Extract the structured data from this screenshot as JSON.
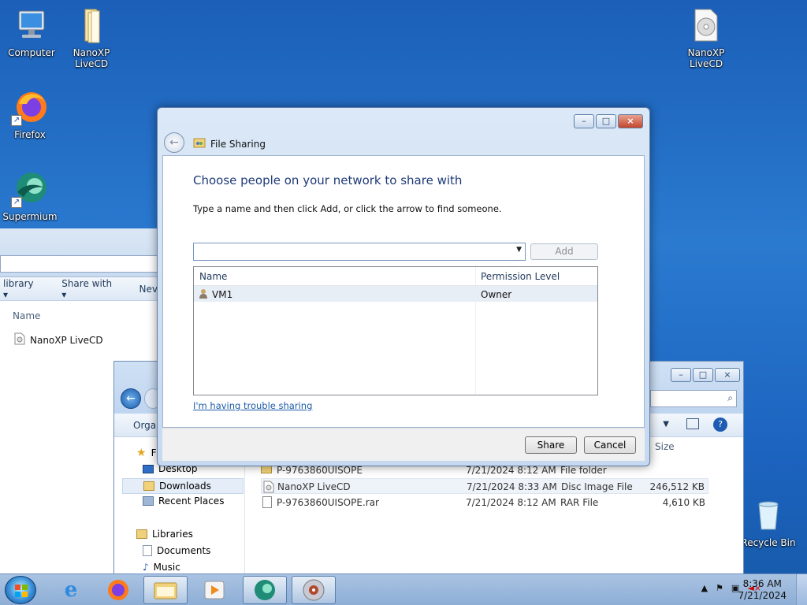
{
  "desktop": {
    "icons": [
      {
        "label": "Computer"
      },
      {
        "label": "NanoXP LiveCD"
      },
      {
        "label": "Firefox"
      },
      {
        "label": "Supermium"
      },
      {
        "label": "NanoXP LiveCD"
      },
      {
        "label": "Recycle Bin"
      }
    ]
  },
  "bg_explorer_left": {
    "toolbar": [
      "library ▾",
      "Share with ▾",
      "Nev"
    ],
    "column_name": "Name",
    "items": [
      "NanoXP LiveCD"
    ]
  },
  "bg_explorer_bottom": {
    "toolbar_left": "Orga",
    "col_size": "Size",
    "nav": {
      "favorites_partial": "F",
      "items": [
        "Desktop",
        "Downloads",
        "Recent Places"
      ],
      "libraries": "Libraries",
      "library_items": [
        "Documents",
        "Music"
      ]
    },
    "files": [
      {
        "name": "P-9763860UISOPE",
        "date": "7/21/2024 8:12 AM",
        "type": "File folder",
        "size": ""
      },
      {
        "name": "NanoXP LiveCD",
        "date": "7/21/2024 8:33 AM",
        "type": "Disc Image File",
        "size": "246,512 KB"
      },
      {
        "name": "P-9763860UISOPE.rar",
        "date": "7/21/2024 8:12 AM",
        "type": "RAR File",
        "size": "4,610 KB"
      }
    ]
  },
  "dialog": {
    "title": "File Sharing",
    "heading": "Choose people on your network to share with",
    "instruction": "Type a name and then click Add, or click the arrow to find someone.",
    "name_input": {
      "value": "",
      "placeholder": ""
    },
    "add_label": "Add",
    "columns": {
      "name": "Name",
      "permission": "Permission Level"
    },
    "rows": [
      {
        "name": "VM1",
        "permission": "Owner"
      }
    ],
    "trouble_link": "I'm having trouble sharing",
    "share_label": "Share",
    "cancel_label": "Cancel"
  },
  "taskbar": {
    "clock_time": "8:36 AM",
    "clock_date": "7/21/2024"
  }
}
